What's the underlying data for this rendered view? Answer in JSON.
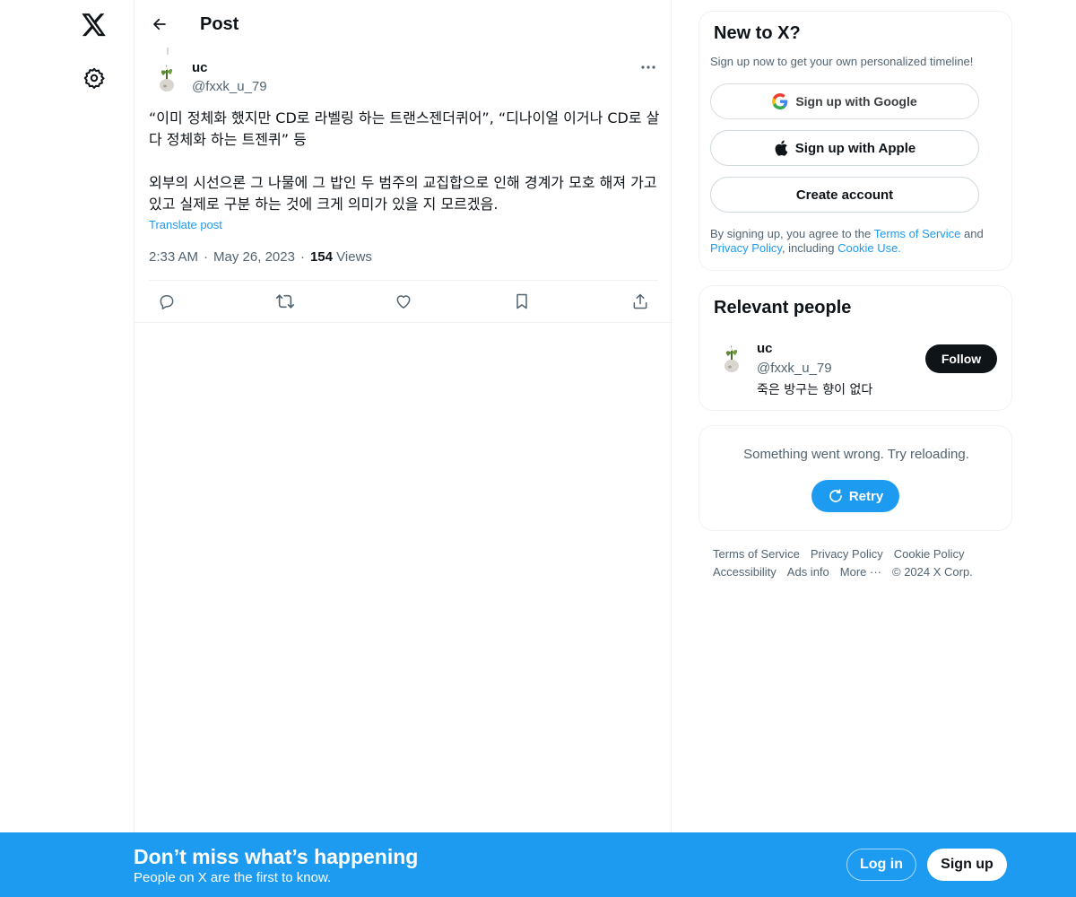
{
  "nav": {
    "logo_icon": "x-logo-icon",
    "settings_icon": "gear-icon"
  },
  "header": {
    "back_icon": "arrow-left-icon",
    "title": "Post"
  },
  "post": {
    "author": {
      "name": "uc",
      "handle": "@fxxk_u_79",
      "avatar_icon": "plant-avatar-icon"
    },
    "more_icon": "ellipsis-icon",
    "text_para1": "“이미 정체화 했지만 CD로 라벨링 하는 트랜스젠더퀴어”, “디나이얼 이거나 CD로 살다 정체화 하는 트젠퀴” 등",
    "text_para2": "외부의 시선으론 그 나물에 그 밥인 두 범주의 교집합으로 인해 경계가 모호 해져 가고 있고 실제로 구분 하는 것에 크게 의미가 있을 지 모르겠음.",
    "translate_label": "Translate post",
    "time": "2:33 AM",
    "separator": "·",
    "date": "May 26, 2023",
    "views_count": "154",
    "views_label": "Views",
    "actions": [
      {
        "icon": "reply-icon"
      },
      {
        "icon": "repost-icon"
      },
      {
        "icon": "like-icon"
      },
      {
        "icon": "bookmark-icon"
      },
      {
        "icon": "share-icon"
      }
    ]
  },
  "signup_card": {
    "title": "New to X?",
    "subtitle": "Sign up now to get your own personalized timeline!",
    "google_label": "Sign up with Google",
    "apple_label": "Sign up with Apple",
    "create_label": "Create account",
    "legal_prefix": "By signing up, you agree to the ",
    "terms_link": "Terms of Service",
    "legal_and": " and ",
    "privacy_link": "Privacy Policy",
    "legal_including": ", including ",
    "cookie_link": "Cookie Use."
  },
  "people_card": {
    "title": "Relevant people",
    "name": "uc",
    "handle": "@fxxk_u_79",
    "bio": "죽은 방구는 향이 없다",
    "follow_label": "Follow"
  },
  "error_card": {
    "message": "Something went wrong. Try reloading.",
    "retry_label": "Retry"
  },
  "footer": {
    "terms": "Terms of Service",
    "privacy": "Privacy Policy",
    "cookie": "Cookie Policy",
    "accessibility": "Accessibility",
    "ads": "Ads info",
    "more": "More ···",
    "copyright": "© 2024 X Corp."
  },
  "banner": {
    "title": "Don’t miss what’s happening",
    "subtitle": "People on X are the first to know.",
    "login_label": "Log in",
    "signup_label": "Sign up"
  },
  "colors": {
    "accent": "#1d9bf0",
    "text": "#0f1419",
    "muted": "#536471",
    "border": "#eff3f4"
  }
}
